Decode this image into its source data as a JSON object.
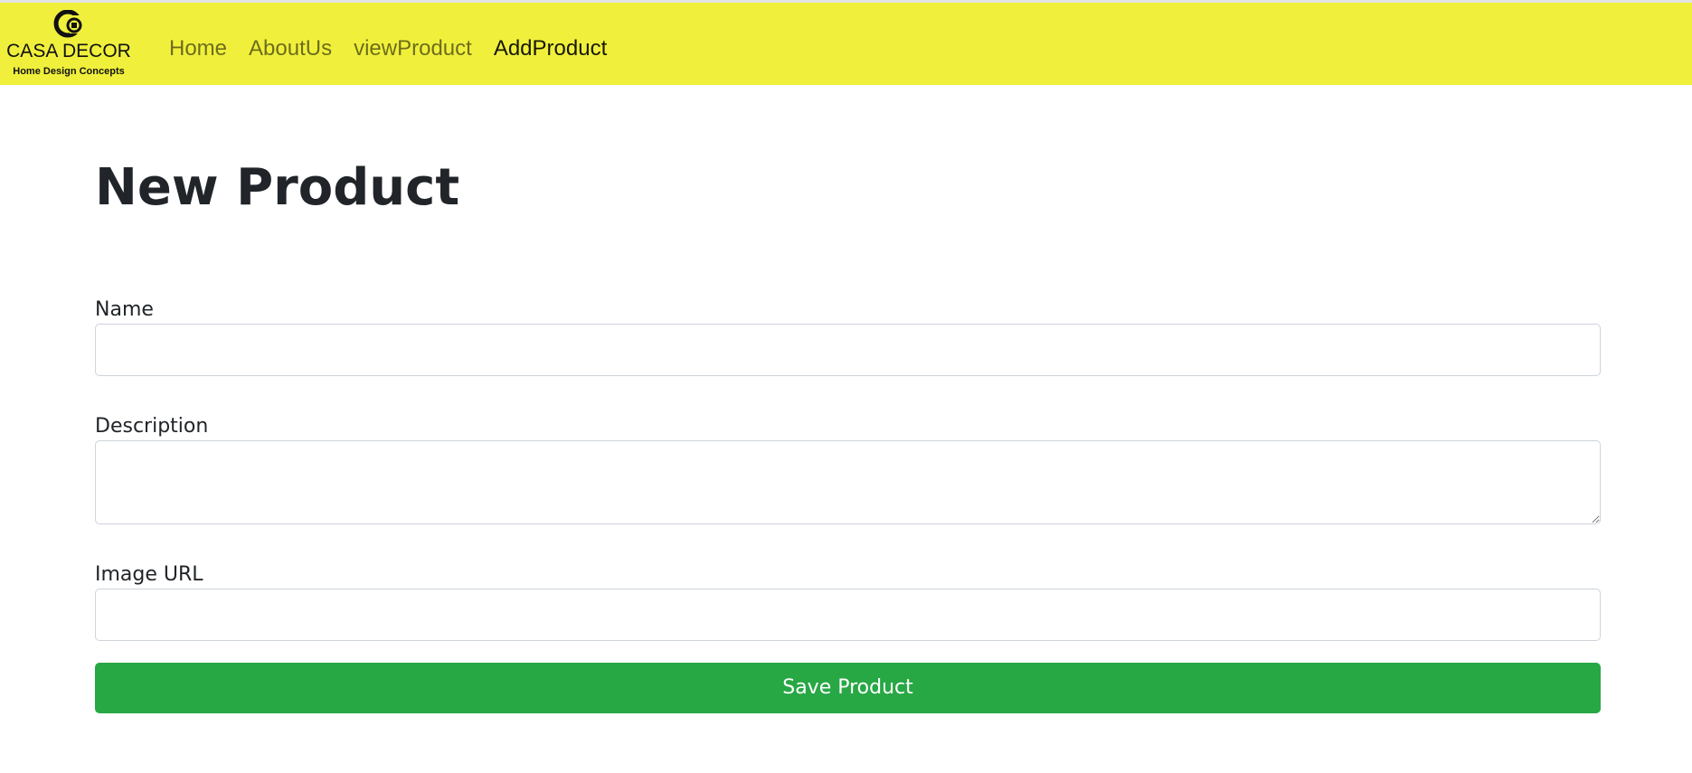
{
  "brand": {
    "icon": "casa-decor-logo-icon",
    "title": "CASA DECOR",
    "subtitle": "Home Design Concepts"
  },
  "nav": {
    "links": [
      {
        "label": "Home",
        "active": false
      },
      {
        "label": "AboutUs",
        "active": false
      },
      {
        "label": "viewProduct",
        "active": false
      },
      {
        "label": "AddProduct",
        "active": true
      }
    ]
  },
  "colors": {
    "navbar_bg": "#f0f03c",
    "button_bg": "#28a745",
    "text": "#212529"
  },
  "form": {
    "title": "New Product",
    "name_label": "Name",
    "name_value": "",
    "description_label": "Description",
    "description_value": "",
    "image_url_label": "Image URL",
    "image_url_value": "",
    "submit_label": "Save Product"
  }
}
